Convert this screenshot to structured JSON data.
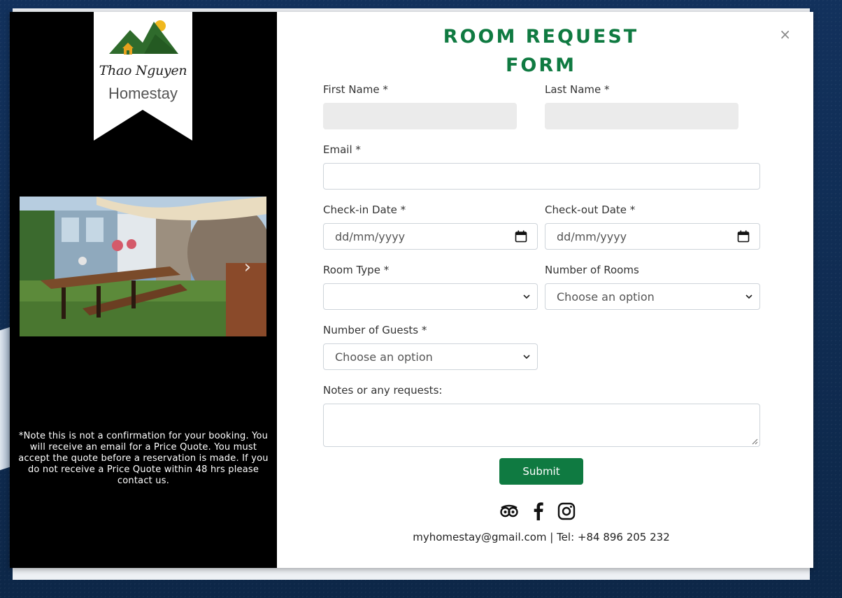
{
  "logo": {
    "line1": "Thao Nguyen",
    "line2": "Homestay"
  },
  "side": {
    "note": "*Note this is not a confirmation for your booking. You will receive an email for a Price Quote. You must accept the quote before a reservation is made. If you do not receive a Price Quote within 48 hrs please contact us."
  },
  "form": {
    "title_line1": "ROOM REQUEST",
    "title_line2": "FORM",
    "close": "×",
    "first_name_label": "First Name *",
    "last_name_label": "Last Name *",
    "email_label": "Email *",
    "checkin_label": "Check-in Date *",
    "checkout_label": "Check-out Date *",
    "date_placeholder": "dd/mm/yyyy",
    "room_type_label": "Room Type *",
    "room_type_value": "",
    "num_rooms_label": "Number of Rooms",
    "num_rooms_value": "Choose an option",
    "num_guests_label": "Number of Guests *",
    "num_guests_value": "Choose an option",
    "notes_label": "Notes or any requests:",
    "submit_label": "Submit"
  },
  "footer": {
    "social_icons": [
      "tripadvisor-icon",
      "facebook-icon",
      "instagram-icon"
    ],
    "contact": "myhomestay@gmail.com | Tel: +84 896 205 232"
  },
  "colors": {
    "accent": "#0f7a41",
    "side_bg": "#000000",
    "page_bg": "#0f2a52"
  }
}
